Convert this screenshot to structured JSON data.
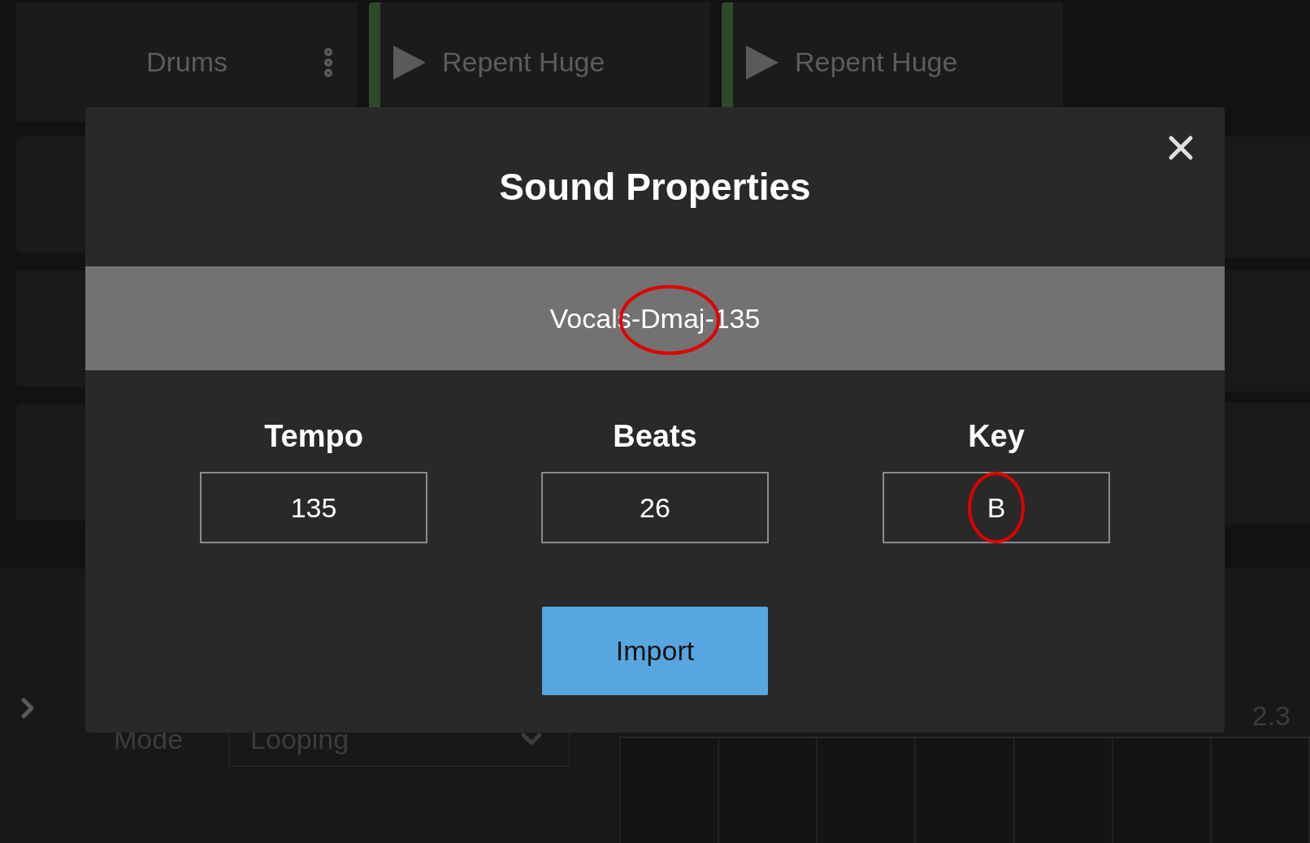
{
  "tracks": [
    {
      "name": "Drums",
      "kind": "label"
    },
    {
      "name": "Repent Huge",
      "kind": "clip"
    },
    {
      "name": "Repent Huge",
      "kind": "clip"
    }
  ],
  "dialog": {
    "title": "Sound Properties",
    "filename": "Vocals-Dmaj-135",
    "filename_circled": true,
    "fields": [
      {
        "label": "Tempo",
        "value": "135",
        "circled": false
      },
      {
        "label": "Beats",
        "value": "26",
        "circled": false
      },
      {
        "label": "Key",
        "value": "B",
        "circled": true
      }
    ],
    "button": "Import"
  },
  "inspector": {
    "mode_label": "Mode",
    "mode_value": "Looping"
  },
  "timeline": {
    "marker": "2.3"
  }
}
